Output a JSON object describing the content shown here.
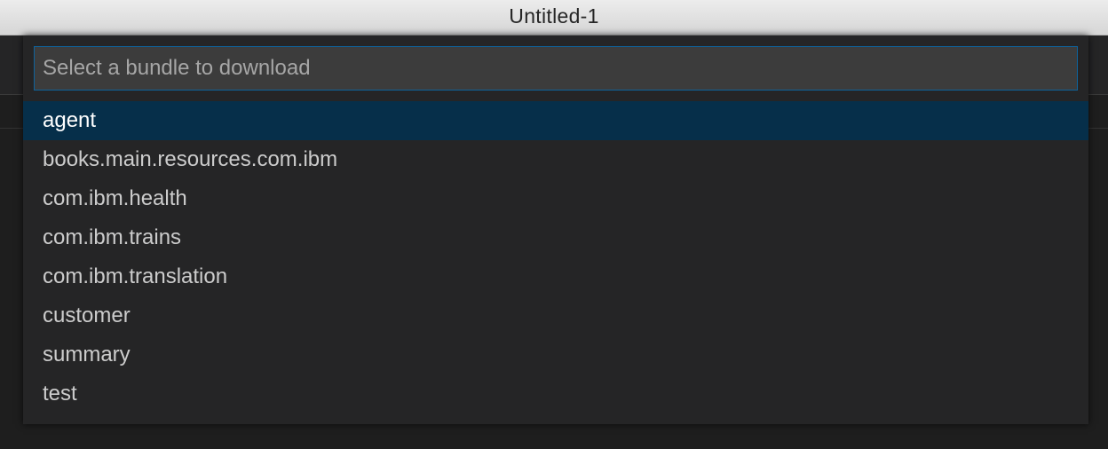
{
  "window": {
    "title": "Untitled-1"
  },
  "quick_open": {
    "placeholder": "Select a bundle to download",
    "value": "",
    "selected_index": 0,
    "items": [
      {
        "label": "agent"
      },
      {
        "label": "books.main.resources.com.ibm"
      },
      {
        "label": "com.ibm.health"
      },
      {
        "label": "com.ibm.trains"
      },
      {
        "label": "com.ibm.translation"
      },
      {
        "label": "customer"
      },
      {
        "label": "summary"
      },
      {
        "label": "test"
      }
    ]
  },
  "colors": {
    "focus_border": "#0e639c",
    "selection_background": "#062f4a",
    "widget_background": "#252526",
    "editor_background": "#1e1e1e"
  }
}
